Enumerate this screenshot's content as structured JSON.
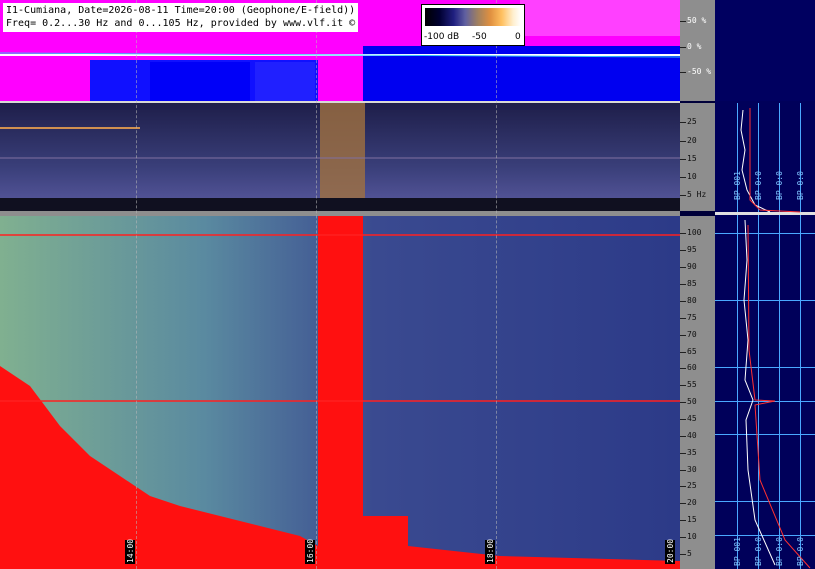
{
  "info": {
    "line1": "I1-Cumiana, Date=2026-08-11 Time=20:00 (Geophone/E-field))",
    "line2": "Freq= 0.2...30 Hz and 0...105 Hz, provided by www.vlf.it ©"
  },
  "legend": {
    "min_label": "-100 dB",
    "mid_label": "-50",
    "max_label": "0"
  },
  "wave_scale": [
    "50 %",
    "0 %",
    "-50 %"
  ],
  "spec1_scale": [
    "25",
    "20",
    "15",
    "10",
    "5 Hz"
  ],
  "spec2_scale": [
    "100",
    "95",
    "90",
    "85",
    "80",
    "75",
    "70",
    "65",
    "60",
    "55",
    "50",
    "45",
    "40",
    "35",
    "30",
    "25",
    "20",
    "15",
    "10",
    "5"
  ],
  "time_labels": [
    "14:00",
    "16:00",
    "18:00",
    "20:00"
  ],
  "panel_top_labels": [
    "BP 001",
    "BP 0:0",
    "BP 0:0",
    "BP 0:0"
  ],
  "panel_bottom_labels": [
    "BP 001",
    "BP 0:0",
    "BP 0:0",
    "BP 0:0"
  ],
  "colors": {
    "wave_bg": "#0000f0",
    "wave_magenta": "#ff00ff",
    "spec_red": "#ff1010",
    "grid_blue": "#4aa8ff"
  }
}
